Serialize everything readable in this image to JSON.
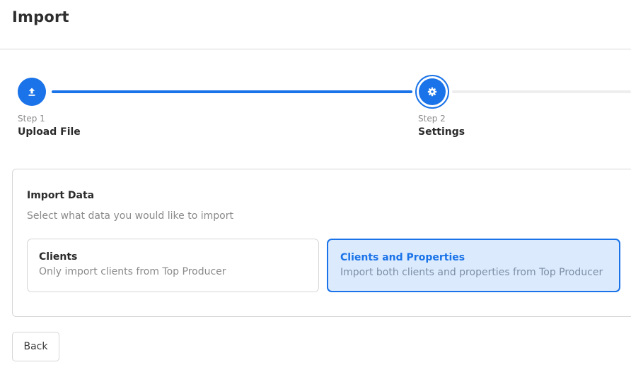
{
  "header": {
    "title": "Import"
  },
  "stepper": {
    "steps": [
      {
        "caption": "Step 1",
        "label": "Upload File",
        "icon": "upload-icon",
        "status": "completed"
      },
      {
        "caption": "Step 2",
        "label": "Settings",
        "icon": "gear-icon",
        "status": "active"
      }
    ]
  },
  "import_data": {
    "title": "Import Data",
    "subtitle": "Select what data you would like to import",
    "options": [
      {
        "title": "Clients",
        "description": "Only import clients from Top Producer",
        "selected": false
      },
      {
        "title": "Clients and Properties",
        "description": "Import both clients and properties from Top Producer",
        "selected": true
      }
    ]
  },
  "actions": {
    "back_label": "Back"
  },
  "colors": {
    "accent": "#1a73e8",
    "selected_bg": "#dbeafd",
    "track_inactive": "#eeeeee"
  }
}
